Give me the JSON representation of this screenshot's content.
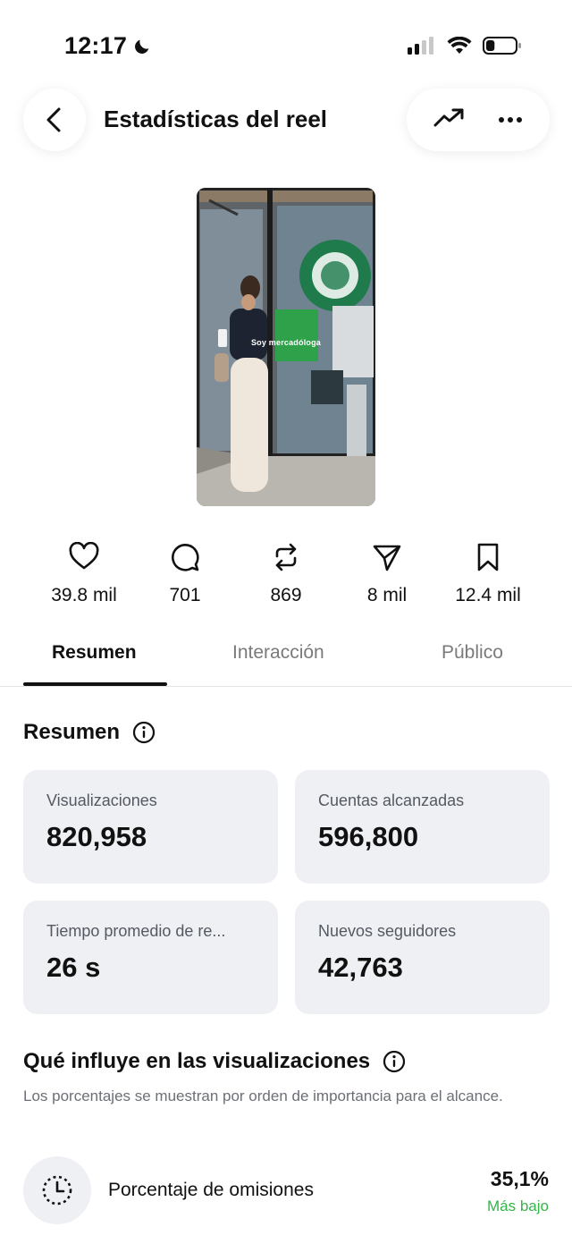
{
  "status_bar": {
    "time": "12:17",
    "battery_level": 0.3
  },
  "header": {
    "title": "Estadísticas del reel"
  },
  "reel": {
    "caption": "Soy mercadóloga"
  },
  "stats": [
    {
      "icon": "heart-icon",
      "value": "39.8 mil"
    },
    {
      "icon": "comment-icon",
      "value": "701"
    },
    {
      "icon": "repost-icon",
      "value": "869"
    },
    {
      "icon": "share-icon",
      "value": "8 mil"
    },
    {
      "icon": "save-icon",
      "value": "12.4 mil"
    }
  ],
  "tabs": [
    {
      "label": "Resumen",
      "active": true
    },
    {
      "label": "Interacción",
      "active": false
    },
    {
      "label": "Público",
      "active": false
    }
  ],
  "summary": {
    "title": "Resumen",
    "cards": [
      {
        "label": "Visualizaciones",
        "value": "820,958"
      },
      {
        "label": "Cuentas alcanzadas",
        "value": "596,800"
      },
      {
        "label": "Tiempo promedio de re...",
        "value": "26 s"
      },
      {
        "label": "Nuevos seguidores",
        "value": "42,763"
      }
    ]
  },
  "influence": {
    "title": "Qué influye en las visualizaciones",
    "description": "Los porcentajes se muestran por orden de importancia para el alcance.",
    "rows": [
      {
        "icon": "timer-icon",
        "label": "Porcentaje de omisiones",
        "value": "35,1%",
        "status": "Más bajo",
        "status_color": "#36b44a"
      }
    ]
  },
  "colors": {
    "card_bg": "#eef0f4",
    "positive": "#36b44a"
  }
}
